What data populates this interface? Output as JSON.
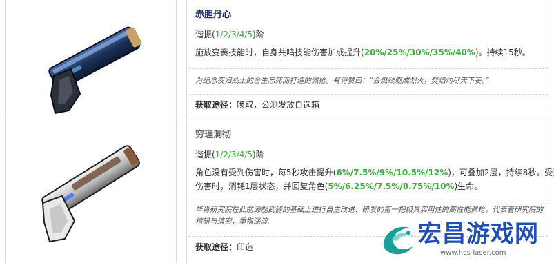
{
  "weapons": [
    {
      "name": "赤胆丹心",
      "resonance_prefix": "谐振(",
      "resonance_levels": "1/2/3/4/5",
      "resonance_suffix": ")阶",
      "effect_line1_prefix": "施放变奏技能时，自身共鸣技能伤害加成提升(",
      "effect_line1_values": "20%/25%/30%/35%/40%",
      "effect_line1_suffix": ")。持续15秒。",
      "quote": "为纪念夜归战士的舍生忘死而打造的佩枪。有诗赞曰：“会燃残躯成烈火，焚焰灼尽天下妄。”",
      "acquire_label": "获取途径：",
      "acquire_value": "唤取，公测发放自选箱"
    },
    {
      "name": "穷理洞彻",
      "resonance_prefix": "谐振(",
      "resonance_levels": "1/2/3/4/5",
      "resonance_suffix": ")阶",
      "effect_line1_prefix": "角色没有受到伤害时，每5秒攻击提升(",
      "effect_line1_values": "6%/7.5%/9%/10.5%/12%",
      "effect_line1_suffix": ")，可叠加2层，持续8秒。受到",
      "effect_line2_prefix": "伤害时，消耗1层状态，并回复角色(",
      "effect_line2_values": "5%/6.25%/7.5%/8.75%/10%",
      "effect_line2_suffix": ")生命。",
      "quote": "华胥研究院在此前源能武器的基础上进行自主改进、研发的第一把极具实用性的高性能佩枪，代表着研究院的精研与缜密，重指深渡。",
      "acquire_label": "获取途径：",
      "acquire_value": "印造"
    }
  ],
  "watermark": {
    "title": "宏昌游戏网",
    "url": "www.hcs-laser.com"
  },
  "colors": {
    "title1": "#1f2a6b",
    "title2": "#666666",
    "highlight": "#3cae3c",
    "grid": "#d9d9d9",
    "watermark_blue": "#1f4fb4",
    "watermark_teal": "#19a09a"
  }
}
